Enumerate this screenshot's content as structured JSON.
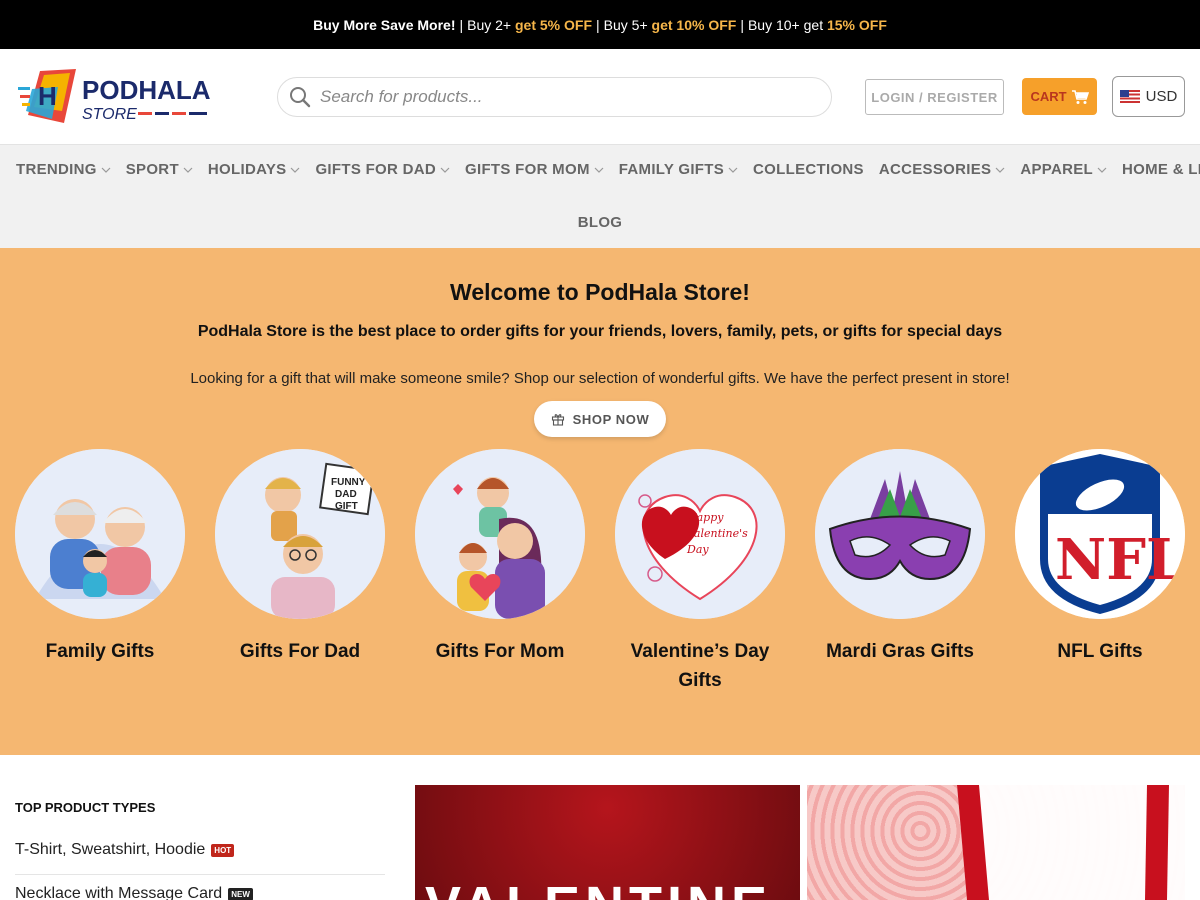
{
  "promo": {
    "lead": "Buy More Save More!",
    "t1": "Buy 2+",
    "h1": "get 5% OFF",
    "t2": "Buy 5+",
    "h2": "get 10% OFF",
    "t3": "Buy 10+ get",
    "h3": "15% OFF",
    "separator": "|"
  },
  "header": {
    "logo_main": "PODHALA",
    "logo_sub": "STORE",
    "search_placeholder": "Search for products...",
    "login_label": "LOGIN / REGISTER",
    "cart_label": "CART",
    "currency": "USD"
  },
  "nav": {
    "items": [
      {
        "label": "TRENDING",
        "dropdown": true
      },
      {
        "label": "SPORT",
        "dropdown": true
      },
      {
        "label": "HOLIDAYS",
        "dropdown": true
      },
      {
        "label": "GIFTS FOR DAD",
        "dropdown": true
      },
      {
        "label": "GIFTS FOR MOM",
        "dropdown": true
      },
      {
        "label": "FAMILY GIFTS",
        "dropdown": true
      },
      {
        "label": "COLLECTIONS",
        "dropdown": false
      },
      {
        "label": "ACCESSORIES",
        "dropdown": true
      },
      {
        "label": "APPAREL",
        "dropdown": true
      },
      {
        "label": "HOME & LIVING",
        "dropdown": true
      }
    ],
    "second_row": "BLOG"
  },
  "hero": {
    "title": "Welcome to PodHala Store!",
    "subtitle": "PodHala Store is the best place to order gifts for your friends, lovers, family, pets, or gifts for special days",
    "description": "Looking for a gift that will make someone smile? Shop our selection of wonderful gifts. We have the perfect present in store!",
    "button": "SHOP NOW",
    "categories": [
      {
        "label": "Family Gifts"
      },
      {
        "label": "Gifts For Dad",
        "image_text": "FUNNY DAD GIFT"
      },
      {
        "label": "Gifts For Mom"
      },
      {
        "label": "Valentine’s Day Gifts",
        "image_text": "Happy Valentine's Day"
      },
      {
        "label": "Mardi Gras Gifts"
      },
      {
        "label": "NFL Gifts",
        "image_text": "NFL"
      }
    ]
  },
  "sidebar": {
    "title": "TOP PRODUCT TYPES",
    "items": [
      {
        "label": "T-Shirt, Sweatshirt, Hoodie",
        "badge": "HOT"
      },
      {
        "label": "Necklace with Message Card",
        "badge": "NEW"
      }
    ]
  },
  "banners": {
    "left_text": "VALENTINE"
  },
  "colors": {
    "accent": "#f6b64a",
    "hero_bg": "#f5b771",
    "cart_bg": "#f6a02a"
  }
}
